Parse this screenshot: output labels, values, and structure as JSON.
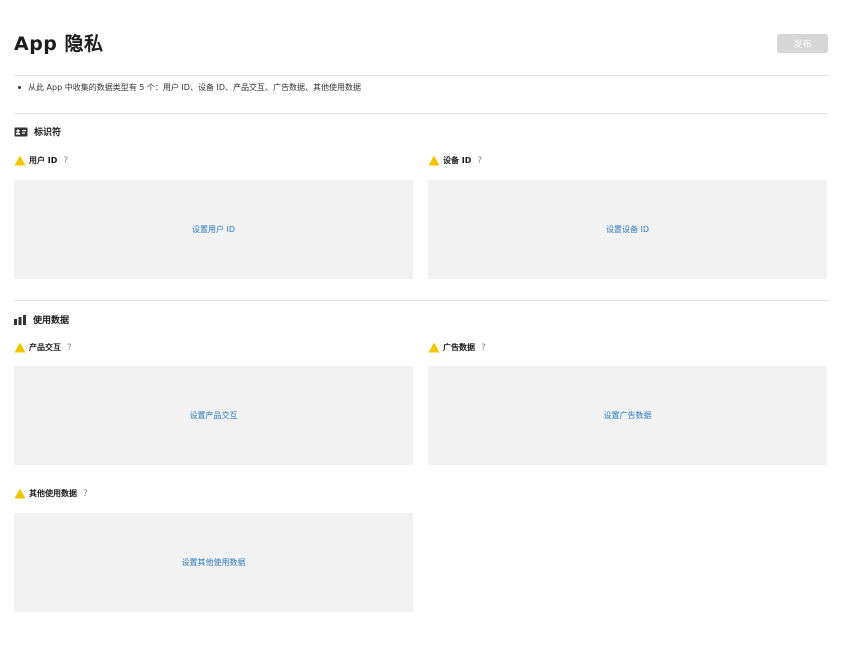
{
  "header": {
    "title": "App 隐私",
    "publish_label": "发布"
  },
  "summary": {
    "text": "从此 App 中收集的数据类型有 5 个：用户 ID、设备 ID、产品交互、广告数据、其他使用数据"
  },
  "sections": {
    "identifiers": {
      "heading": "标识符",
      "icon": "id-card-icon",
      "items": {
        "user_id": {
          "label": "用户 ID",
          "help": "?",
          "link": "设置用户 ID"
        },
        "device_id": {
          "label": "设备 ID",
          "help": "?",
          "link": "设置设备 ID"
        }
      }
    },
    "usage": {
      "heading": "使用数据",
      "icon": "bar-chart-icon",
      "items": {
        "product_interaction": {
          "label": "产品交互",
          "help": "?",
          "link": "设置产品交互"
        },
        "advertising_data": {
          "label": "广告数据",
          "help": "?",
          "link": "设置广告数据"
        },
        "other_usage": {
          "label": "其他使用数据",
          "help": "?",
          "link": "设置其他使用数据"
        }
      }
    }
  },
  "colors": {
    "warning": "#f5c400",
    "link": "#2c7bc1",
    "panel": "#f2f2f2",
    "button_disabled": "#d6d6d6"
  }
}
